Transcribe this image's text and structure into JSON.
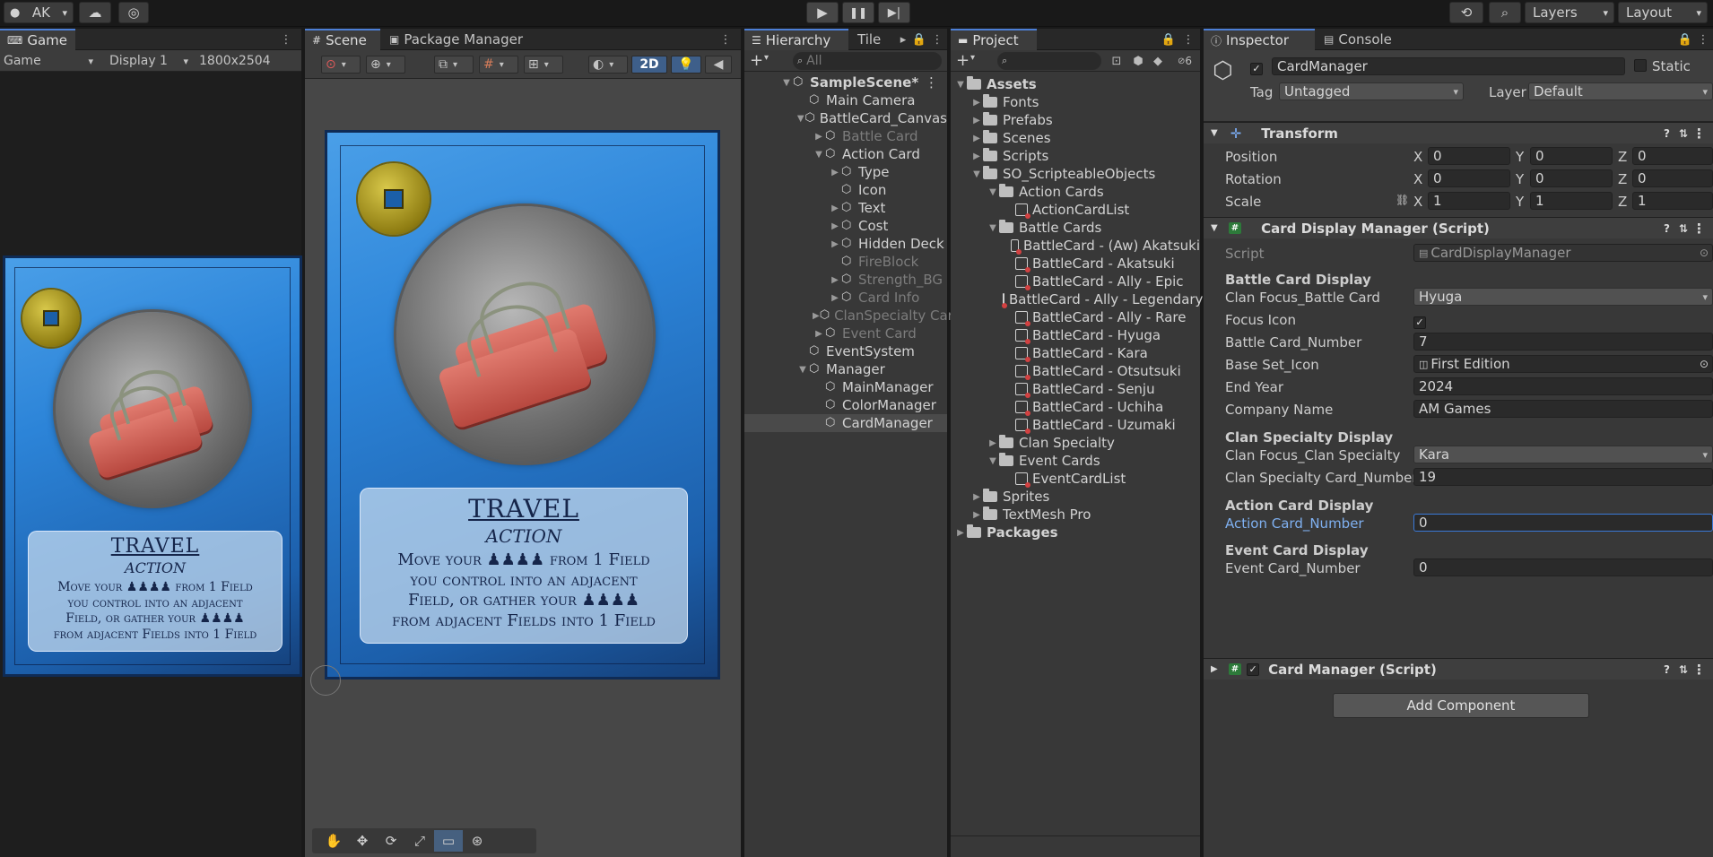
{
  "toolbar": {
    "account": "AK",
    "account_caret": "▾",
    "cloud_icon": "cloud-icon",
    "collab_icon": "collab-icon",
    "play": "▶",
    "pause": "❚❚",
    "step": "▶|",
    "history_icon": "history-icon",
    "search_icon": "search-icon",
    "layers": "Layers",
    "layout": "Layout"
  },
  "game": {
    "tab": "Game",
    "mode": "Game",
    "display": "Display 1",
    "resolution": "1800x2504",
    "menu": "⋮"
  },
  "scene": {
    "tabs": [
      "Scene",
      "Package Manager"
    ],
    "btn_2d": "2D",
    "menu": "⋮"
  },
  "card": {
    "title": "TRAVEL",
    "subtitle": "ACTION",
    "line1_a": "Move your",
    "line1_b": "from 1 Field",
    "line2": "you control into an adjacent",
    "line3_a": "Field, or gather your",
    "line4": "from adjacent Fields into 1 Field",
    "pawns": "♟♟♟♟"
  },
  "hierarchy": {
    "tab": "Hierarchy",
    "tab2": "Tile",
    "search_placeholder": "All",
    "add": "+",
    "items": [
      {
        "label": "SampleScene*",
        "indent": 0,
        "arrow": "▼",
        "icon": "unity-scene-icon",
        "dim": false,
        "bold": true
      },
      {
        "label": "Main Camera",
        "indent": 1,
        "arrow": "",
        "icon": "gameobject-icon",
        "dim": false
      },
      {
        "label": "BattleCard_Canvas",
        "indent": 1,
        "arrow": "▼",
        "icon": "gameobject-icon",
        "dim": false
      },
      {
        "label": "Battle Card",
        "indent": 2,
        "arrow": "▶",
        "icon": "gameobject-icon",
        "dim": true
      },
      {
        "label": "Action Card",
        "indent": 2,
        "arrow": "▼",
        "icon": "gameobject-icon",
        "dim": false
      },
      {
        "label": "Type",
        "indent": 3,
        "arrow": "▶",
        "icon": "gameobject-icon",
        "dim": false
      },
      {
        "label": "Icon",
        "indent": 3,
        "arrow": "",
        "icon": "gameobject-icon",
        "dim": false
      },
      {
        "label": "Text",
        "indent": 3,
        "arrow": "▶",
        "icon": "gameobject-icon",
        "dim": false
      },
      {
        "label": "Cost",
        "indent": 3,
        "arrow": "▶",
        "icon": "gameobject-icon",
        "dim": false
      },
      {
        "label": "Hidden Deck",
        "indent": 3,
        "arrow": "▶",
        "icon": "gameobject-icon",
        "dim": false
      },
      {
        "label": "FireBlock",
        "indent": 3,
        "arrow": "",
        "icon": "gameobject-icon",
        "dim": true
      },
      {
        "label": "Strength_BG",
        "indent": 3,
        "arrow": "▶",
        "icon": "gameobject-icon",
        "dim": true
      },
      {
        "label": "Card Info",
        "indent": 3,
        "arrow": "▶",
        "icon": "gameobject-icon",
        "dim": true
      },
      {
        "label": "ClanSpecialty Card",
        "indent": 2,
        "arrow": "▶",
        "icon": "gameobject-icon",
        "dim": true
      },
      {
        "label": "Event Card",
        "indent": 2,
        "arrow": "▶",
        "icon": "gameobject-icon",
        "dim": true
      },
      {
        "label": "EventSystem",
        "indent": 1,
        "arrow": "",
        "icon": "gameobject-icon",
        "dim": false
      },
      {
        "label": "Manager",
        "indent": 1,
        "arrow": "▼",
        "icon": "gameobject-icon",
        "dim": false
      },
      {
        "label": "MainManager",
        "indent": 2,
        "arrow": "",
        "icon": "gameobject-icon",
        "dim": false
      },
      {
        "label": "ColorManager",
        "indent": 2,
        "arrow": "",
        "icon": "gameobject-icon",
        "dim": false
      },
      {
        "label": "CardManager",
        "indent": 2,
        "arrow": "",
        "icon": "gameobject-icon",
        "dim": false,
        "selected": true
      }
    ]
  },
  "project": {
    "tab": "Project",
    "add": "+",
    "badge": "6",
    "items": [
      {
        "label": "Assets",
        "indent": 0,
        "arrow": "▼",
        "type": "folder",
        "bold": true
      },
      {
        "label": "Fonts",
        "indent": 1,
        "arrow": "▶",
        "type": "folder"
      },
      {
        "label": "Prefabs",
        "indent": 1,
        "arrow": "▶",
        "type": "folder"
      },
      {
        "label": "Scenes",
        "indent": 1,
        "arrow": "▶",
        "type": "folder"
      },
      {
        "label": "Scripts",
        "indent": 1,
        "arrow": "▶",
        "type": "folder"
      },
      {
        "label": "SO_ScripteableObjects",
        "indent": 1,
        "arrow": "▼",
        "type": "folder"
      },
      {
        "label": "Action Cards",
        "indent": 2,
        "arrow": "▼",
        "type": "folder"
      },
      {
        "label": "ActionCardList",
        "indent": 3,
        "arrow": "",
        "type": "so"
      },
      {
        "label": "Battle Cards",
        "indent": 2,
        "arrow": "▼",
        "type": "folder"
      },
      {
        "label": "BattleCard - (Aw) Akatsuki",
        "indent": 3,
        "arrow": "",
        "type": "so"
      },
      {
        "label": "BattleCard - Akatsuki",
        "indent": 3,
        "arrow": "",
        "type": "so"
      },
      {
        "label": "BattleCard - Ally - Epic",
        "indent": 3,
        "arrow": "",
        "type": "so"
      },
      {
        "label": "BattleCard - Ally - Legendary",
        "indent": 3,
        "arrow": "",
        "type": "so"
      },
      {
        "label": "BattleCard - Ally - Rare",
        "indent": 3,
        "arrow": "",
        "type": "so"
      },
      {
        "label": "BattleCard - Hyuga",
        "indent": 3,
        "arrow": "",
        "type": "so"
      },
      {
        "label": "BattleCard - Kara",
        "indent": 3,
        "arrow": "",
        "type": "so"
      },
      {
        "label": "BattleCard - Otsutsuki",
        "indent": 3,
        "arrow": "",
        "type": "so"
      },
      {
        "label": "BattleCard - Senju",
        "indent": 3,
        "arrow": "",
        "type": "so"
      },
      {
        "label": "BattleCard - Uchiha",
        "indent": 3,
        "arrow": "",
        "type": "so"
      },
      {
        "label": "BattleCard - Uzumaki",
        "indent": 3,
        "arrow": "",
        "type": "so"
      },
      {
        "label": "Clan Specialty",
        "indent": 2,
        "arrow": "▶",
        "type": "folder"
      },
      {
        "label": "Event Cards",
        "indent": 2,
        "arrow": "▼",
        "type": "folder"
      },
      {
        "label": "EventCardList",
        "indent": 3,
        "arrow": "",
        "type": "so"
      },
      {
        "label": "Sprites",
        "indent": 1,
        "arrow": "▶",
        "type": "folder"
      },
      {
        "label": "TextMesh Pro",
        "indent": 1,
        "arrow": "▶",
        "type": "folder"
      },
      {
        "label": "Packages",
        "indent": 0,
        "arrow": "▶",
        "type": "folder",
        "bold": true
      }
    ]
  },
  "inspector": {
    "tab": "Inspector",
    "tab2": "Console",
    "object_name": "CardManager",
    "static_label": "Static",
    "tag_label": "Tag",
    "tag_value": "Untagged",
    "layer_label": "Layer",
    "layer_value": "Default",
    "transform": {
      "title": "Transform",
      "position_label": "Position",
      "rotation_label": "Rotation",
      "scale_label": "Scale",
      "x": "X",
      "y": "Y",
      "z": "Z",
      "pos": [
        "0",
        "0",
        "0"
      ],
      "rot": [
        "0",
        "0",
        "0"
      ],
      "scl": [
        "1",
        "1",
        "1"
      ]
    },
    "cdm": {
      "title": "Card Display Manager (Script)",
      "script_label": "Script",
      "script_value": "CardDisplayManager",
      "h_battle": "Battle Card Display",
      "clan_focus_battle_label": "Clan Focus_Battle Card",
      "clan_focus_battle_value": "Hyuga",
      "focus_icon_label": "Focus Icon",
      "focus_icon_check": "✓",
      "battle_num_label": "Battle Card_Number",
      "battle_num_value": "7",
      "base_set_label": "Base Set_Icon",
      "base_set_value": "First Edition",
      "end_year_label": "End Year",
      "end_year_value": "2024",
      "company_label": "Company Name",
      "company_value": "AM Games",
      "h_clan": "Clan Specialty Display",
      "clan_focus_cs_label": "Clan Focus_Clan Specialty",
      "clan_focus_cs_value": "Kara",
      "clan_num_label": "Clan Specialty Card_Number",
      "clan_num_value": "19",
      "h_action": "Action Card Display",
      "action_num_label": "Action Card_Number",
      "action_num_value": "0",
      "h_event": "Event Card Display",
      "event_num_label": "Event Card_Number",
      "event_num_value": "0"
    },
    "card_manager_title": "Card Manager (Script)",
    "add_component": "Add Component"
  }
}
